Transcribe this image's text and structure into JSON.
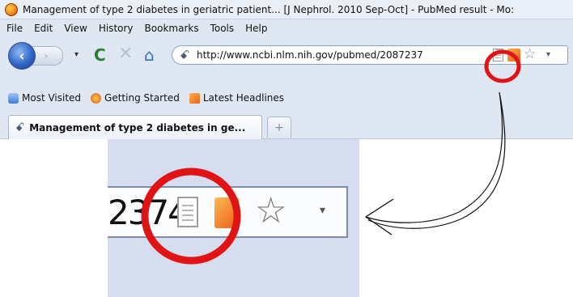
{
  "window": {
    "title": "Management of type 2 diabetes in geriatric patient... [J Nephrol. 2010 Sep-Oct] - PubMed result - Mo:"
  },
  "menubar": {
    "items": [
      "File",
      "Edit",
      "View",
      "History",
      "Bookmarks",
      "Tools",
      "Help"
    ]
  },
  "navbar": {
    "back_glyph": "‹",
    "forward_glyph": "›",
    "dropdown_glyph": "▾",
    "reload_glyph": "C",
    "stop_glyph": "✕",
    "home_glyph": "⌂",
    "url": "http://www.ncbi.nlm.nih.gov/pubmed/2087237",
    "site_icon_glyph": "ꗃ",
    "star_glyph": "☆",
    "url_dropdown_glyph": "▾"
  },
  "bookmarks_toolbar": {
    "items": [
      "Most Visited",
      "Getting Started",
      "Latest Headlines"
    ]
  },
  "tabs": {
    "active_title": "Management of type 2 diabetes in ge...",
    "new_tab_glyph": "+"
  },
  "zoom_inset": {
    "url_fragment": "2374",
    "star_glyph": "☆",
    "dropdown_glyph": "▾"
  },
  "annotation_colors": {
    "circle": "#e01414",
    "arrow": "#111111"
  },
  "icons": {
    "titlebar": "firefox-logo-icon",
    "back": "back-arrow-icon",
    "forward": "forward-arrow-icon",
    "reload": "reload-icon",
    "stop": "stop-icon",
    "home": "home-icon",
    "site": "site-identity-icon",
    "page": "page-document-icon",
    "rss": "rss-feed-icon",
    "star": "bookmark-star-icon"
  }
}
